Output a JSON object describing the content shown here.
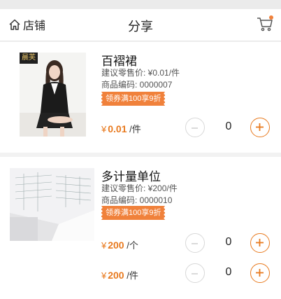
{
  "header": {
    "store_label": "店铺",
    "title": "分享"
  },
  "colors": {
    "accent": "#e87a1f",
    "promo_bg": "#f0813b",
    "cart_dot": "#f0813b"
  },
  "products": [
    {
      "name": "百褶裙",
      "suggested_price": "建议零售价: ¥0.01/件",
      "code": "商品编码: 0000007",
      "promo": "领券满100享9折",
      "brand_tag": "晨芙",
      "skus": [
        {
          "currency": "¥",
          "price": "0.01",
          "unit": "/件",
          "qty": "0"
        }
      ]
    },
    {
      "name": "多计量单位",
      "suggested_price": "建议零售价: ¥200/件",
      "code": "商品编码: 0000010",
      "promo": "领券满100享9折",
      "skus": [
        {
          "currency": "¥",
          "price": "200",
          "unit": "/个",
          "qty": "0"
        },
        {
          "currency": "¥",
          "price": "200",
          "unit": "/件",
          "qty": "0"
        }
      ]
    }
  ]
}
